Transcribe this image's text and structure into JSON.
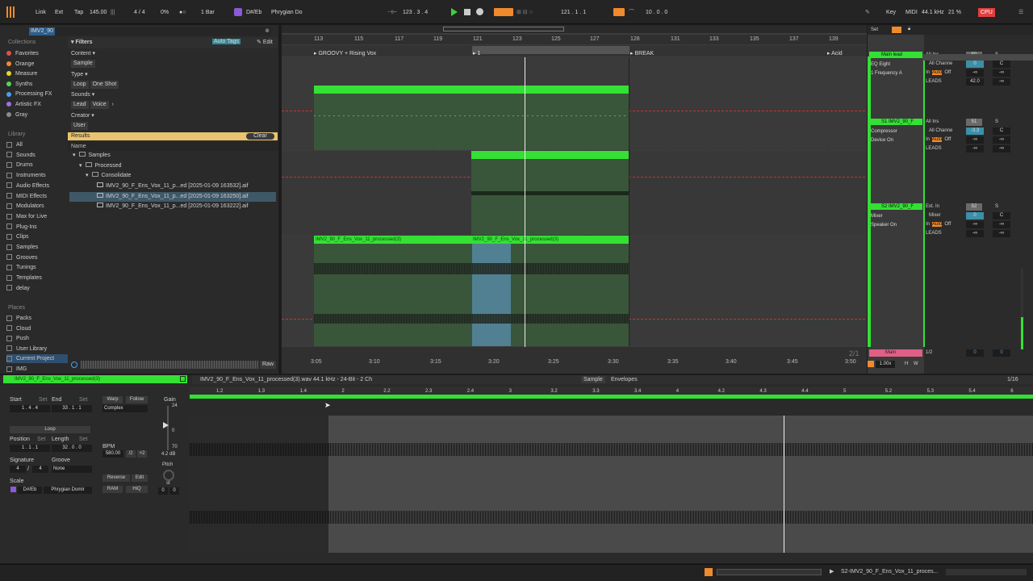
{
  "colors": {
    "accent": "#f08a2c",
    "clip_green": "#34e034",
    "selection": "#5a8fb0",
    "pink": "#e05f86"
  },
  "topbar": {
    "link": "Link",
    "ext": "Ext",
    "tap": "Tap",
    "tempo": "145.00",
    "signature": "4 / 4",
    "pct": "0%",
    "bar": "1 Bar",
    "key": "D#/Eb",
    "scale": "Phrygian Do",
    "position": "123 .  3 .  4",
    "loop_start": "121 .  1 .  1",
    "loop_len": "10 .  0 .  0",
    "key_btn": "Key",
    "midi": "MIDI",
    "sample_rate": "44.1 kHz",
    "cpu_pct": "21 %",
    "cpu": "CPU"
  },
  "browser": {
    "search": "IMV2_90",
    "collections_title": "Collections",
    "collections": [
      {
        "label": "Favorites",
        "color": "#e05050"
      },
      {
        "label": "Orange",
        "color": "#f08a2c"
      },
      {
        "label": "Measure",
        "color": "#e6d62e"
      },
      {
        "label": "Synths",
        "color": "#54d654"
      },
      {
        "label": "Processing FX",
        "color": "#4aa0e8"
      },
      {
        "label": "Artistic FX",
        "color": "#a070e0"
      },
      {
        "label": "Gray",
        "color": "#8a8a8a"
      }
    ],
    "library_title": "Library",
    "library": [
      "All",
      "Sounds",
      "Drums",
      "Instruments",
      "Audio Effects",
      "MIDI Effects",
      "Modulators",
      "Max for Live",
      "Plug-Ins",
      "Clips",
      "Samples",
      "Grooves",
      "Tunings",
      "Templates",
      "delay"
    ],
    "places_title": "Places",
    "places": [
      "Packs",
      "Cloud",
      "Push",
      "User Library",
      "Current Project",
      "IMG"
    ],
    "filters": "Filters",
    "auto_tags": "Auto Tags",
    "edit": "Edit",
    "content": "Content",
    "content_tag": "Sample",
    "type": "Type",
    "type_tags": [
      "Loop",
      "One Shot"
    ],
    "sounds": "Sounds",
    "sounds_tags": [
      "Lead",
      "Voice"
    ],
    "creator": "Creator",
    "creator_tag": "User",
    "results": "Results",
    "clear": "Clear",
    "name_col": "Name",
    "tree": [
      "Samples",
      "Processed",
      "Consolidate"
    ],
    "files": [
      "IMV2_90_F_Ens_Vox_11_p...ed [2025-01-09 163532].aif",
      "IMV2_90_F_Ens_Vox_11_p...ed [2025-01-09 163250].aif",
      "IMV2_90_F_Ens_Vox_11_p...ed [2025-01-09 163222].aif"
    ],
    "raw": "Raw"
  },
  "arrangement": {
    "bars": [
      "113",
      "115",
      "117",
      "119",
      "121",
      "123",
      "125",
      "127",
      "128",
      "131",
      "133",
      "135",
      "137",
      "139"
    ],
    "locators": [
      "GROOVY + Rising Vox",
      "1",
      "BREAK",
      "Acid"
    ],
    "clip_name": "IMV2_90_F_Ens_Vox_11_processed(3)",
    "times": [
      "3:05",
      "3:10",
      "3:15",
      "3:20",
      "3:25",
      "3:30",
      "3:35",
      "3:40",
      "3:45",
      "3:50"
    ],
    "page": "2/1"
  },
  "mixer": {
    "set": "Set",
    "tracks": [
      {
        "name": "Main lead",
        "input": "All Ins",
        "channel": "All Channe",
        "vol": "50",
        "pan": "C",
        "monitor": [
          "In",
          "Auto",
          "Off"
        ],
        "out": "LEADS",
        "devices": [
          "EQ Eight",
          "1 Frequency A"
        ],
        "fields": [
          "0",
          "-∞",
          "-∞",
          "42.0",
          "-∞"
        ]
      },
      {
        "name": "S1 IMV2_90_F",
        "input": "All Ins",
        "channel": "All Channe",
        "vol": "51",
        "pan": "C",
        "monitor": [
          "In",
          "Auto",
          "Off"
        ],
        "out": "LEADS",
        "devices": [
          "Compressor",
          "Device On"
        ],
        "fields": [
          "-3.3",
          "-∞",
          "-∞",
          "-∞",
          "-∞"
        ]
      },
      {
        "name": "S2 IMV2_90_F",
        "input": "Ext. In",
        "channel": "Mixer",
        "vol": "52",
        "pan": "C",
        "monitor": [
          "In",
          "Auto",
          "Off"
        ],
        "out": "LEADS",
        "devices": [
          "Mixer",
          "Speaker On"
        ],
        "fields": [
          "0",
          "-∞",
          "-∞",
          "-∞",
          "-∞"
        ]
      }
    ],
    "main": "Main",
    "main_out": "1/2",
    "main_vol": "0",
    "main_pan": "0",
    "zoom": "1.00x",
    "h": "H",
    "w": "W"
  },
  "detail": {
    "clip_title": "IMV2_90_F_Ens_Vox_11_processed(3)",
    "file_info": "IMV2_90_F_Ens_Vox_11_processed(3).wav  44.1 kHz - 24-Bit - 2 Ch",
    "tabs": [
      "Sample",
      "Envelopes"
    ],
    "page": "1/16",
    "start": "Start",
    "end": "End",
    "set": "Set",
    "start_val": "1 .  4 .  4",
    "end_val": "33 .  1 .  1",
    "loop": "Loop",
    "position": "Position",
    "length": "Length",
    "pos_val": "1 .  1 .  1",
    "len_val": "32 .  0 .  0",
    "signature": "Signature",
    "groove": "Groove",
    "sig_num": "4",
    "sig_den": "4",
    "groove_val": "None",
    "scale": "Scale",
    "scale_key": "D#/Eb",
    "scale_name": "Phrygian Domir",
    "warp": "Warp",
    "follow": "Follow",
    "mode": "Complex",
    "bpm_label": "BPM",
    "bpm": "580.00",
    "half": "/2",
    "double": "×2",
    "reverse": "Reverse",
    "edit": "Edit",
    "ram": "RAM",
    "hiq": "HiQ",
    "gain_label": "Gain",
    "gain_top": "24",
    "gain_mid": "0",
    "gain_bot": "70",
    "gain_db": "4.2 dB",
    "pitch": "Pitch",
    "st": "st",
    "pitch_vals": [
      "0",
      "0"
    ],
    "ruler": [
      "1.2",
      "1.3",
      "1.4",
      "2",
      "2.2",
      "2.3",
      "2.4",
      "3",
      "3.2",
      "3.3",
      "3.4",
      "4",
      "4.2",
      "4.3",
      "4.4",
      "5",
      "5.2",
      "5.3",
      "5.4",
      "6"
    ]
  },
  "status": {
    "track_label": "S2-IMV2_90_F_Ens_Vox_11_proces..."
  }
}
